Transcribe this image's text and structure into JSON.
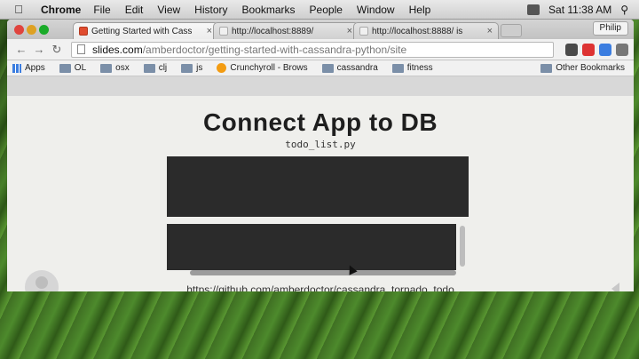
{
  "menubar": {
    "app_name": "Chrome",
    "menus": [
      "File",
      "Edit",
      "View",
      "History",
      "Bookmarks",
      "People",
      "Window",
      "Help"
    ],
    "clock": "Sat 11:38 AM"
  },
  "browser": {
    "profile_name": "Philip",
    "tabs": [
      {
        "label": "Getting Started with Cass",
        "close": "×"
      },
      {
        "label": "http://localhost:8889/",
        "close": "×"
      },
      {
        "label": "http://localhost:8888/ is",
        "close": "×"
      }
    ],
    "url": {
      "host": "slides.com",
      "path": "/amberdoctor/getting-started-with-cassandra-python/site"
    },
    "bookmarks": [
      "Apps",
      "OL",
      "osx",
      "clj",
      "js",
      "Crunchyroll - Brows",
      "cassandra",
      "fitness"
    ],
    "other_bookmarks": "Other Bookmarks"
  },
  "slide": {
    "title": "Connect App to DB",
    "subtitle": "todo_list.py",
    "link": "https://github.com/amberdoctor/cassandra_tornado_todo"
  },
  "icons": {
    "back": "back-arrow-icon",
    "forward": "forward-arrow-icon",
    "reload": "reload-icon",
    "avatar": "user-avatar-icon"
  }
}
